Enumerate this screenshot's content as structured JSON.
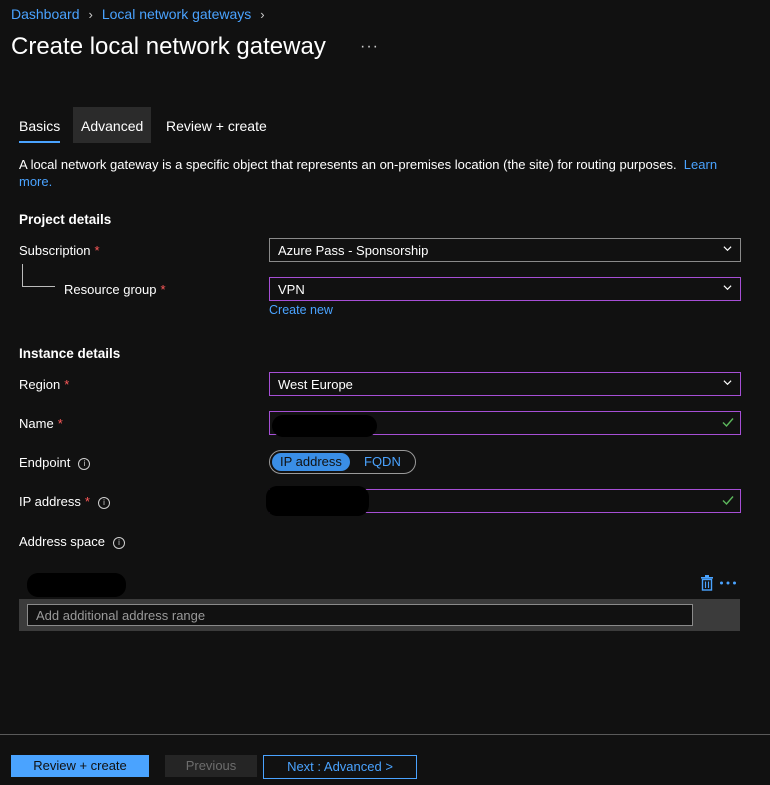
{
  "breadcrumb": {
    "items": [
      "Dashboard",
      "Local network gateways"
    ],
    "separator": "›"
  },
  "page": {
    "title": "Create local network gateway",
    "more": "···"
  },
  "tabs": [
    {
      "label": "Basics",
      "active": true
    },
    {
      "label": "Advanced",
      "active": false
    },
    {
      "label": "Review + create",
      "active": false
    }
  ],
  "description": {
    "text": "A local network gateway is a specific object that represents an on-premises location (the site) for routing purposes.",
    "link": "Learn more."
  },
  "project_details": {
    "heading": "Project details",
    "subscription": {
      "label": "Subscription",
      "required": "*",
      "value": "Azure Pass - Sponsorship"
    },
    "resource_group": {
      "label": "Resource group",
      "required": "*",
      "value": "VPN",
      "create_new": "Create new"
    }
  },
  "instance_details": {
    "heading": "Instance details",
    "region": {
      "label": "Region",
      "required": "*",
      "value": "West Europe"
    },
    "name": {
      "label": "Name",
      "required": "*"
    },
    "endpoint": {
      "label": "Endpoint",
      "options": [
        "IP address",
        "FQDN"
      ],
      "selected": "IP address"
    },
    "ip_address": {
      "label": "IP address",
      "required": "*"
    },
    "address_space": {
      "label": "Address space",
      "placeholder": "Add additional address range"
    }
  },
  "footer": {
    "review_create": "Review + create",
    "previous": "Previous",
    "next": "Next : Advanced >"
  },
  "colors": {
    "accent": "#4aa3ff",
    "focus_border": "#a64fd6",
    "required": "#ff5a5a",
    "valid": "#5cb85c"
  }
}
